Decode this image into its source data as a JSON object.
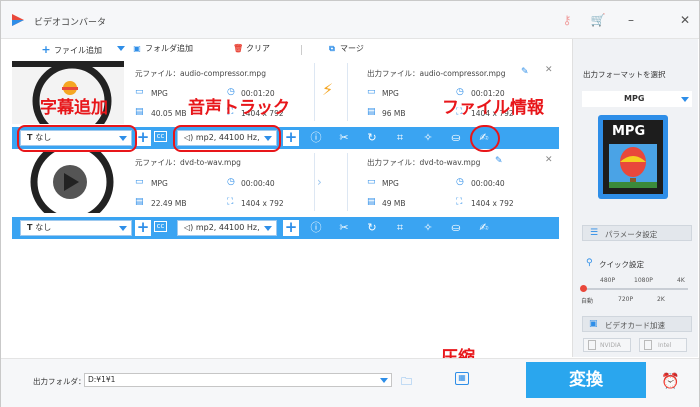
{
  "app": {
    "title": "ビデオコンバータ"
  },
  "toolbar": {
    "add_file": "ファイル追加",
    "add_folder": "フォルダ追加",
    "clear": "クリア",
    "merge": "マージ"
  },
  "items": [
    {
      "source_label": "元ファイル：audio-compressor.mpg",
      "source_format": "MPG",
      "source_duration": "00:01:20",
      "source_size": "40.05 MB",
      "source_resolution": "1404 x 792",
      "output_label": "出力ファイル：audio-compressor.mpg",
      "output_format": "MPG",
      "output_duration": "00:01:20",
      "output_size": "96 MB",
      "output_resolution": "1404 x 792",
      "subtitle": "なし",
      "audio": "mp2, 44100 Hz,"
    },
    {
      "source_label": "元ファイル：dvd-to-wav.mpg",
      "source_format": "MPG",
      "source_duration": "00:00:40",
      "source_size": "22.49 MB",
      "source_resolution": "1404 x 792",
      "output_label": "出力ファイル：dvd-to-wav.mpg",
      "output_format": "MPG",
      "output_duration": "00:00:40",
      "output_size": "49 MB",
      "output_resolution": "1404 x 792",
      "subtitle": "なし",
      "audio": "mp2, 44100 Hz,"
    }
  ],
  "annotations": {
    "subtitle_add": "字幕追加",
    "audio_track": "音声トラック",
    "file_info": "ファイル情報",
    "compress": "圧縮"
  },
  "right_panel": {
    "output_format_title": "出力フォーマットを選択",
    "format": "MPG",
    "format_badge": "MPG",
    "param_button": "パラメータ設定",
    "quick_title": "クイック設定",
    "quality_top": [
      "480P",
      "1080P",
      "4K"
    ],
    "quality_bottom": [
      "自動",
      "720P",
      "2K"
    ],
    "quality_position": 0,
    "gpu_title": "ビデオカード加速",
    "gpu_nvidia": "NVIDIA",
    "gpu_intel": "Intel"
  },
  "bottom": {
    "folder_label": "出力フォルダ：",
    "folder_path": "D:¥1¥1",
    "convert": "変換"
  },
  "colors": {
    "accent": "#2e8ee8",
    "bar": "#3aa4f2",
    "annotation": "#e8161a",
    "convert": "#2aa6ee"
  }
}
